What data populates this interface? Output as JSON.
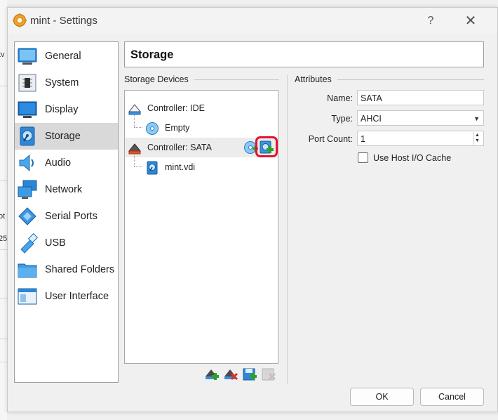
{
  "window": {
    "title": "mint - Settings",
    "help_glyph": "?",
    "close_glyph": "✕"
  },
  "sidebar": {
    "selected": "Storage",
    "items": [
      {
        "label": "General",
        "icon": "general-icon"
      },
      {
        "label": "System",
        "icon": "system-icon"
      },
      {
        "label": "Display",
        "icon": "display-icon"
      },
      {
        "label": "Storage",
        "icon": "storage-icon"
      },
      {
        "label": "Audio",
        "icon": "audio-icon"
      },
      {
        "label": "Network",
        "icon": "network-icon"
      },
      {
        "label": "Serial Ports",
        "icon": "serial-ports-icon"
      },
      {
        "label": "USB",
        "icon": "usb-icon"
      },
      {
        "label": "Shared Folders",
        "icon": "shared-folders-icon"
      },
      {
        "label": "User Interface",
        "icon": "user-interface-icon"
      }
    ]
  },
  "page": {
    "title": "Storage"
  },
  "storage_devices": {
    "label": "Storage Devices",
    "tree": [
      {
        "label": "Controller: IDE",
        "type": "controller"
      },
      {
        "label": "Empty",
        "type": "optical-drive"
      },
      {
        "label": "Controller: SATA",
        "type": "controller",
        "selected": true
      },
      {
        "label": "mint.vdi",
        "type": "hard-disk"
      }
    ]
  },
  "attributes": {
    "label": "Attributes",
    "name_label": "Name:",
    "name_value": "SATA",
    "type_label": "Type:",
    "type_value": "AHCI",
    "port_count_label": "Port Count:",
    "port_count_value": "1",
    "host_io_cache_label": "Use Host I/O Cache",
    "host_io_cache_checked": false
  },
  "buttons": {
    "ok": "OK",
    "cancel": "Cancel"
  },
  "colors": {
    "highlight": "#e8112d",
    "selection": "#d9d9d9",
    "accent_blue": "#1e7fd0"
  },
  "background_fragments": [
    "tv",
    "ot",
    "25"
  ]
}
